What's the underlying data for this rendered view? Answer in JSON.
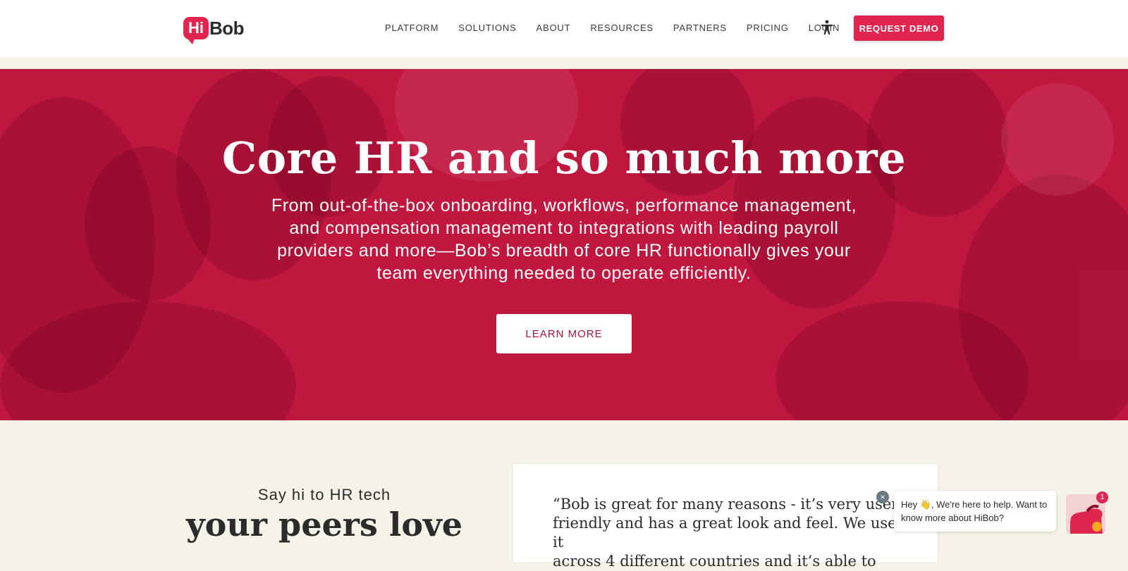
{
  "brand": {
    "logo_hi": "Hi",
    "logo_name": "Bob",
    "accent": "#e0264f",
    "hero_bg": "#c0173f",
    "page_bg": "#f5f3e8"
  },
  "nav": {
    "items": [
      "PLATFORM",
      "SOLUTIONS",
      "ABOUT",
      "RESOURCES",
      "PARTNERS",
      "PRICING",
      "LOGIN"
    ],
    "accessibility_icon": "accessibility-icon",
    "cta": "REQUEST DEMO"
  },
  "hero": {
    "title": "Core HR and so much more",
    "lines": [
      "From out-of-the-box onboarding, workflows, performance management,",
      "and compensation management to integrations with leading payroll",
      "providers and more—Bob’s breadth of core HR functionally gives your",
      "team everything needed to operate efficiently."
    ],
    "button": "LEARN MORE"
  },
  "reviews": {
    "kicker": "Say hi to HR tech",
    "heading": "your peers love",
    "quote_lines": [
      "“Bob is great for many reasons - it’s very user-",
      "friendly and has a great look and feel. We use it",
      "across 4 different countries and it’s able to"
    ]
  },
  "chat": {
    "close": "×",
    "line1": "Hey 👋, We're here to help. Want to",
    "line2": "know more about HiBob?",
    "badge": "1"
  }
}
